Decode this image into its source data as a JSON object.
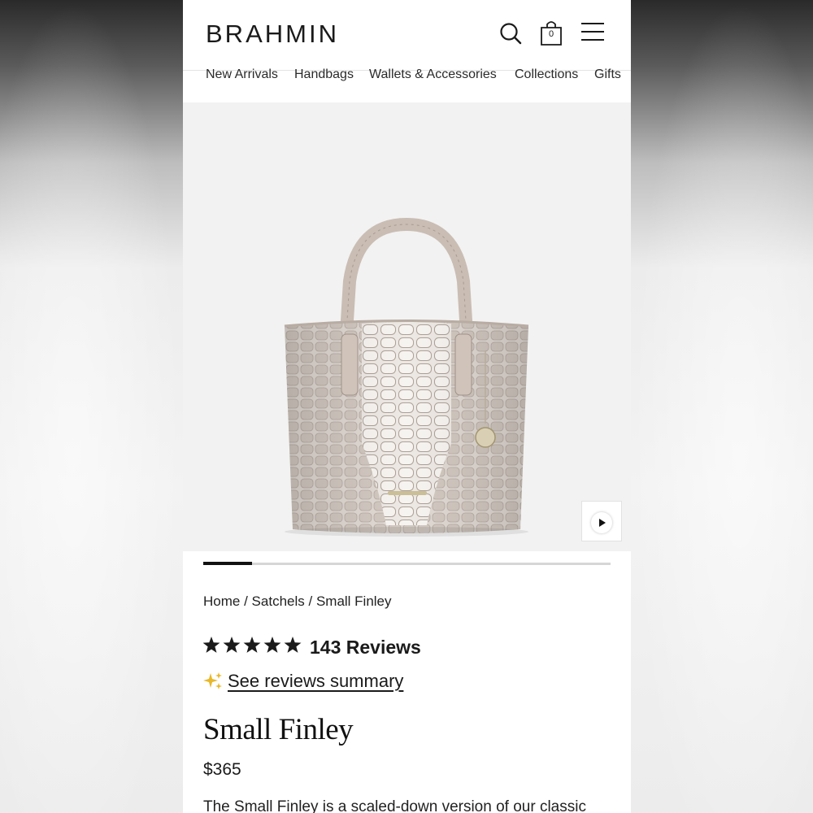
{
  "header": {
    "logo": "BRAHMIN",
    "cart_count": "0",
    "icons": [
      "search-icon",
      "shopping-bag-icon",
      "hamburger-menu-icon"
    ]
  },
  "nav": {
    "items": [
      "New Arrivals",
      "Handbags",
      "Wallets & Accessories",
      "Collections",
      "Gifts"
    ]
  },
  "gallery": {
    "image_index_progress": 0.12,
    "video_thumbnail_icon": "play-icon"
  },
  "breadcrumb": {
    "items": [
      "Home",
      "Satchels",
      "Small Finley"
    ],
    "separator": "/"
  },
  "rating": {
    "stars": 5,
    "count_label": "143 Reviews"
  },
  "reviews_summary": {
    "icon": "sparkle-icon",
    "label": "See reviews summary"
  },
  "product": {
    "title": "Small Finley",
    "price": "$365",
    "description_preview": "The Small Finley is a scaled-down version of our classic"
  },
  "colors": {
    "text": "#1a1a1a",
    "hero_bg": "#f2f2f2",
    "sparkle": "#e8b82a",
    "progress_active": "#111111"
  }
}
